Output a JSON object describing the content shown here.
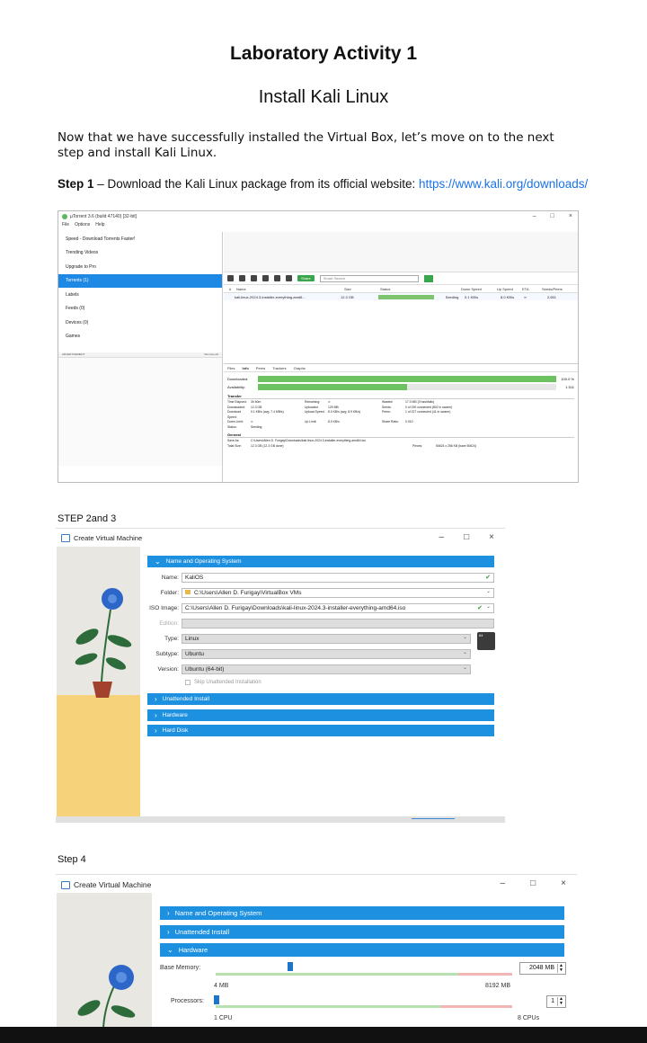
{
  "title": "Laboratory Activity 1",
  "subtitle": "Install Kali Linux",
  "intro": "Now that we have successfully installed the Virtual Box, let’s move on to the next step and install Kali Linux.",
  "step1": {
    "label": "Step 1",
    "text": " – Download the Kali Linux package from its official website: ",
    "url": "https://www.kali.org/downloads/"
  },
  "utorrent": {
    "window_title": "µTorrent 3.6 (build 47140) [32-bit]",
    "menu": [
      "File",
      "Options",
      "Help"
    ],
    "sidebar": [
      "Speed - Download Torrents Faster!",
      "Trending Videos",
      "Upgrade to Pro",
      "Torrents (1)",
      "Labels",
      "Feeds (0)",
      "Devices (0)",
      "Games"
    ],
    "ad_left": "ADVERTISEMENT",
    "ad_right": "Remove Ad",
    "share_label": "Share",
    "search_placeholder": "Smart Search",
    "columns": [
      "#",
      "Name",
      "Size",
      "Status",
      "Down Speed",
      "Up Speed",
      "ETA",
      "Seeds/Peers"
    ],
    "row": {
      "name": "kali-linux-2024.3-installer-everything-amd6...",
      "size": "12.3 GB",
      "status": "Seeding",
      "down": "0.1 KB/s",
      "up": "8.0 KB/s",
      "eta": "∞",
      "seeds": "2,651"
    },
    "tabs": [
      "Files",
      "Info",
      "Peers",
      "Trackers",
      "Graphs"
    ],
    "downloaded_label": "Downloaded:",
    "downloaded_pct": "100.0 %",
    "availability_label": "Availability:",
    "availability_val": "1.511",
    "downloaded_fill": 1.0,
    "availability_fill": 0.5,
    "transfer_label": "Transfer",
    "transfer": [
      [
        "Time Elapsed:",
        "3h 60m",
        "Remaining:",
        "∞",
        "Wasted:",
        "17.0 MB (0 hashfails)"
      ],
      [
        "Downloaded:",
        "12.3 GB",
        "Uploaded:",
        "129 MB",
        "Seeds:",
        "0 of 190 connected (802 in swarm)"
      ],
      [
        "Download Speed:",
        "0.1 KB/s (avg. 7.4 MB/s)",
        "Upload Speed:",
        "8.0 KB/s (avg. 8.9 KB/s)",
        "Peers:",
        "1 of 227 connected (41 in swarm)"
      ],
      [
        "Down Limit:",
        "∞",
        "Up Limit:",
        "8.0 KB/s",
        "Share Ratio:",
        "0.010"
      ],
      [
        "Status:",
        "Seeding",
        "",
        "",
        "",
        ""
      ]
    ],
    "general_label": "General",
    "general": [
      [
        "Save As:",
        "C:\\Users\\Allen D. Furigay\\Downloads\\kali-linux-2024.3-installer-everything-amd64.iso",
        "",
        ""
      ],
      [
        "Total Size:",
        "12.3 GB (12.3 GB done)",
        "Pieces:",
        "50624 x 256 KB (have 50624)"
      ]
    ]
  },
  "step23_label": "STEP 2and 3",
  "vb1": {
    "window_title": "Create Virtual Machine",
    "section_name": "Name and Operating System",
    "name_label": "Name:",
    "name_value": "KaliOS",
    "folder_label": "Folder:",
    "folder_value": "C:\\Users\\Allen D. Furigay\\VirtualBox VMs",
    "iso_label": "ISO Image:",
    "iso_value": "C:\\Users\\Allen D. Furigay\\Downloads\\kali-linux-2024.3-installer-everything-amd64.iso",
    "edition_label": "Edition:",
    "edition_value": "",
    "type_label": "Type:",
    "type_value": "Linux",
    "subtype_label": "Subtype:",
    "subtype_value": "Ubuntu",
    "version_label": "Version:",
    "version_value": "Ubuntu (64-bit)",
    "os_badge": "64",
    "skip_label": "Skip Unattended Installation",
    "section_unattended": "Unattended Install",
    "section_hardware": "Hardware",
    "section_harddisk": "Hard Disk"
  },
  "step4_label": "Step 4",
  "vb2": {
    "window_title": "Create Virtual Machine",
    "section_name": "Name and Operating System",
    "section_unattended": "Unattended Install",
    "section_hardware": "Hardware",
    "base_memory_label": "Base Memory:",
    "base_memory_value": "2048 MB",
    "mem_min": "4 MB",
    "mem_max": "8192 MB",
    "memory_fill": 0.25,
    "processors_label": "Processors:",
    "processors_value": "1",
    "cpu_min": "1 CPU",
    "cpu_max": "8 CPUs"
  }
}
